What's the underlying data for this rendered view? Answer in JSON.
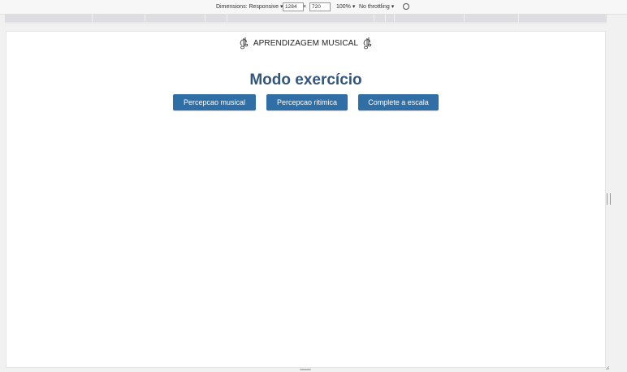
{
  "devtools": {
    "dimensions_label": "Dimensions: Responsive",
    "width_value": "1284",
    "times": "×",
    "height_value": "720",
    "zoom": "100%",
    "throttling": "No throttling"
  },
  "page": {
    "header_title": "APRENDIZAGEM MUSICAL",
    "title": "Modo exercício",
    "buttons": [
      {
        "label": "Percepcao musical"
      },
      {
        "label": "Percepcao ritimica"
      },
      {
        "label": "Complete a escala"
      }
    ],
    "button_color": "#2f6fa6",
    "title_color": "#34567d"
  },
  "icons": [
    "music-notes-icon",
    "rotate-icon",
    "dropdown-arrow-icon",
    "resize-handle-icon"
  ]
}
